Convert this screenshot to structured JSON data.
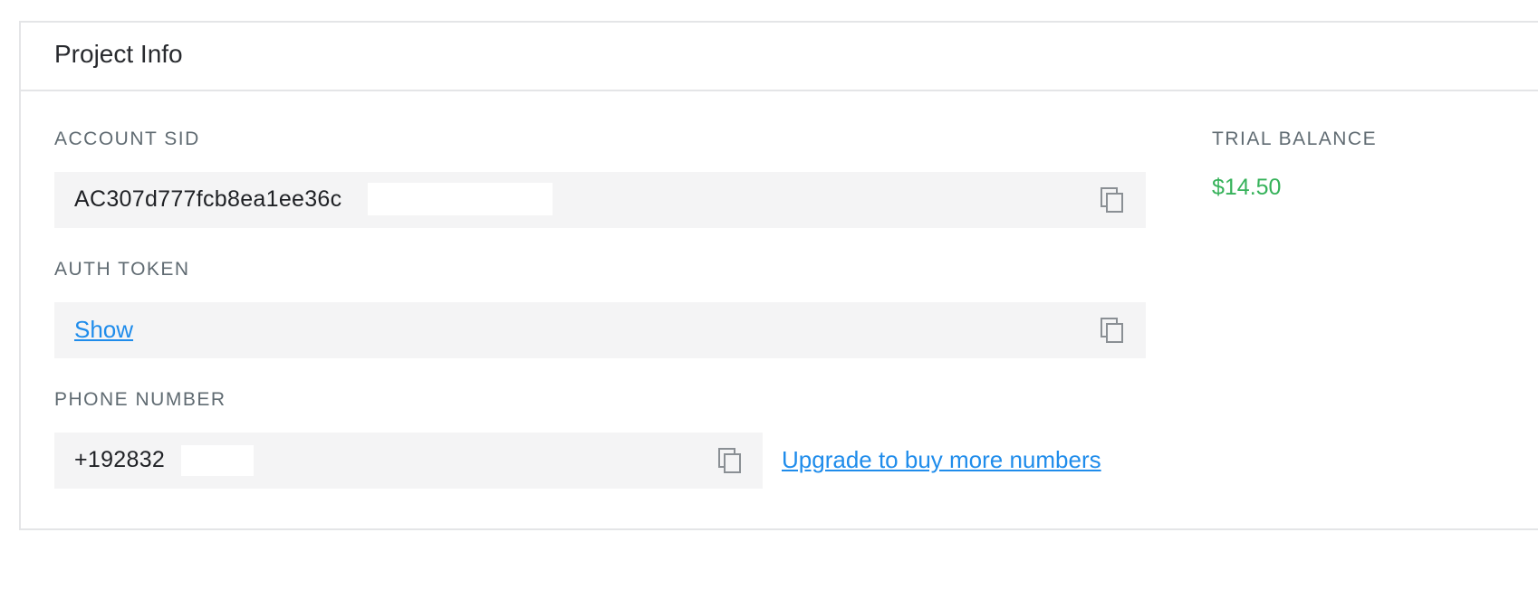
{
  "panel": {
    "title": "Project Info"
  },
  "account_sid": {
    "label": "ACCOUNT SID",
    "value": "AC307d777fcb8ea1ee36c"
  },
  "auth_token": {
    "label": "AUTH TOKEN",
    "show_link": "Show"
  },
  "phone_number": {
    "label": "PHONE NUMBER",
    "value": "+192832",
    "upgrade_link": "Upgrade to buy more numbers"
  },
  "trial_balance": {
    "label": "TRIAL BALANCE",
    "value": "$14.50"
  },
  "icons": {
    "copy": "copy-icon"
  },
  "colors": {
    "link": "#1f8ceb",
    "balance": "#36b25a",
    "field_bg": "#f4f4f5",
    "border": "#e4e5e7"
  }
}
